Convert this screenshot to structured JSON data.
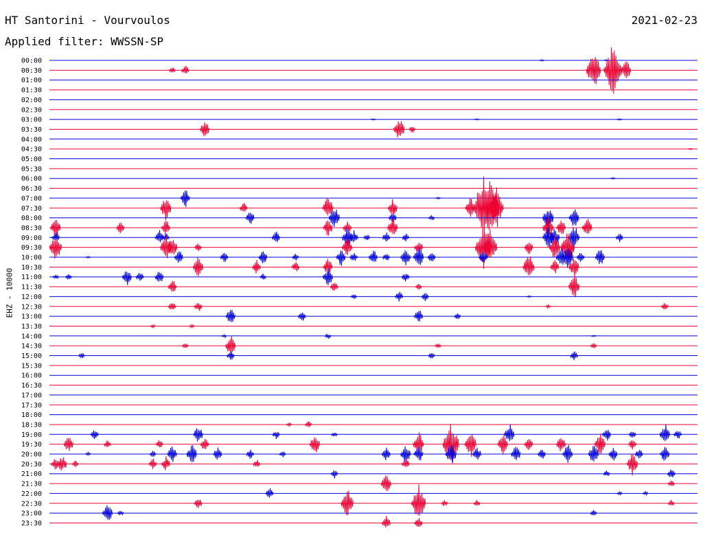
{
  "header": {
    "station": "HT Santorini - Vourvoulos",
    "date": "2021-02-23",
    "filter": "Applied filter: WWSSN-SP"
  },
  "channel_label": "EHZ - 10000",
  "colors": {
    "even_hour": "#0000dd",
    "half_hour": "#ee0033"
  },
  "chart_data": {
    "type": "line",
    "title": "HT Santorini - Vourvoulos",
    "ylabel": "EHZ - 10000",
    "date": "2021-02-23",
    "filter": "WWSSN-SP",
    "ticks": [
      "00:00",
      "00:30",
      "01:00",
      "01:30",
      "02:00",
      "02:30",
      "03:00",
      "03:30",
      "04:00",
      "04:30",
      "05:00",
      "05:30",
      "06:00",
      "06:30",
      "07:00",
      "07:30",
      "08:00",
      "08:30",
      "09:00",
      "09:30",
      "10:00",
      "10:30",
      "11:00",
      "11:30",
      "12:00",
      "12:30",
      "13:00",
      "13:30",
      "14:00",
      "14:30",
      "15:00",
      "15:30",
      "16:00",
      "16:30",
      "17:00",
      "17:30",
      "18:00",
      "18:30",
      "19:00",
      "19:30",
      "20:00",
      "20:30",
      "21:00",
      "21:30",
      "22:00",
      "22:30",
      "23:00",
      "23:30"
    ],
    "trace_minutes": 30,
    "series": [
      {
        "trace": "00:00",
        "events": [
          [
            0.76,
            0.1
          ],
          [
            0.86,
            0.1
          ]
        ]
      },
      {
        "trace": "00:30",
        "events": [
          [
            0.19,
            0.4
          ],
          [
            0.21,
            0.6
          ],
          [
            0.84,
            2.2
          ],
          [
            0.87,
            3.0
          ],
          [
            0.89,
            1.2
          ]
        ]
      },
      {
        "trace": "01:00",
        "events": []
      },
      {
        "trace": "01:30",
        "events": []
      },
      {
        "trace": "02:00",
        "events": []
      },
      {
        "trace": "02:30",
        "events": []
      },
      {
        "trace": "03:00",
        "events": [
          [
            0.5,
            0.1
          ],
          [
            0.66,
            0.1
          ],
          [
            0.88,
            0.1
          ]
        ]
      },
      {
        "trace": "03:30",
        "events": [
          [
            0.24,
            1.0
          ],
          [
            0.54,
            1.3
          ],
          [
            0.56,
            0.4
          ]
        ]
      },
      {
        "trace": "04:00",
        "events": []
      },
      {
        "trace": "04:30",
        "events": [
          [
            0.99,
            0.1
          ]
        ]
      },
      {
        "trace": "05:00",
        "events": []
      },
      {
        "trace": "05:30",
        "events": []
      },
      {
        "trace": "06:00",
        "events": [
          [
            0.87,
            0.1
          ]
        ]
      },
      {
        "trace": "06:30",
        "events": []
      },
      {
        "trace": "07:00",
        "events": [
          [
            0.21,
            1.0
          ],
          [
            0.6,
            0.1
          ]
        ]
      },
      {
        "trace": "07:30",
        "events": [
          [
            0.18,
            1.4
          ],
          [
            0.3,
            0.6
          ],
          [
            0.43,
            1.3
          ],
          [
            0.53,
            1.0
          ],
          [
            0.65,
            1.2
          ],
          [
            0.67,
            3.5
          ],
          [
            0.68,
            3.0
          ],
          [
            0.69,
            2.2
          ]
        ]
      },
      {
        "trace": "08:00",
        "events": [
          [
            0.31,
            0.8
          ],
          [
            0.44,
            1.3
          ],
          [
            0.53,
            0.6
          ],
          [
            0.59,
            0.3
          ],
          [
            0.77,
            1.3
          ],
          [
            0.81,
            1.2
          ]
        ]
      },
      {
        "trace": "08:30",
        "events": [
          [
            0.01,
            1.1
          ],
          [
            0.11,
            0.7
          ],
          [
            0.18,
            0.9
          ],
          [
            0.43,
            1.0
          ],
          [
            0.46,
            0.8
          ],
          [
            0.53,
            1.2
          ],
          [
            0.77,
            1.4
          ],
          [
            0.79,
            1.0
          ],
          [
            0.83,
            1.1
          ]
        ]
      },
      {
        "trace": "09:00",
        "events": [
          [
            0.01,
            0.6
          ],
          [
            0.17,
            0.8
          ],
          [
            0.18,
            0.5
          ],
          [
            0.35,
            0.7
          ],
          [
            0.46,
            1.2
          ],
          [
            0.47,
            0.8
          ],
          [
            0.49,
            0.4
          ],
          [
            0.52,
            0.6
          ],
          [
            0.55,
            0.5
          ],
          [
            0.77,
            1.3
          ],
          [
            0.78,
            1.1
          ],
          [
            0.81,
            1.4
          ],
          [
            0.88,
            0.5
          ]
        ]
      },
      {
        "trace": "09:30",
        "events": [
          [
            0.01,
            1.6
          ],
          [
            0.18,
            1.4
          ],
          [
            0.19,
            1.2
          ],
          [
            0.23,
            0.5
          ],
          [
            0.46,
            1.2
          ],
          [
            0.57,
            0.8
          ],
          [
            0.67,
            2.5
          ],
          [
            0.68,
            2.1
          ],
          [
            0.74,
            0.8
          ],
          [
            0.78,
            1.4
          ],
          [
            0.8,
            2.0
          ]
        ]
      },
      {
        "trace": "10:00",
        "events": [
          [
            0.06,
            0.1
          ],
          [
            0.2,
            0.8
          ],
          [
            0.27,
            0.6
          ],
          [
            0.33,
            0.8
          ],
          [
            0.38,
            0.4
          ],
          [
            0.45,
            1.0
          ],
          [
            0.47,
            0.6
          ],
          [
            0.5,
            0.9
          ],
          [
            0.52,
            0.5
          ],
          [
            0.55,
            1.1
          ],
          [
            0.57,
            1.2
          ],
          [
            0.59,
            0.6
          ],
          [
            0.67,
            0.8
          ],
          [
            0.79,
            1.1
          ],
          [
            0.8,
            1.3
          ],
          [
            0.82,
            0.6
          ],
          [
            0.85,
            1.0
          ]
        ]
      },
      {
        "trace": "10:30",
        "events": [
          [
            0.23,
            1.2
          ],
          [
            0.32,
            0.8
          ],
          [
            0.38,
            0.6
          ],
          [
            0.43,
            1.0
          ],
          [
            0.74,
            1.5
          ],
          [
            0.78,
            0.8
          ],
          [
            0.81,
            1.1
          ]
        ]
      },
      {
        "trace": "11:00",
        "events": [
          [
            0.01,
            0.3
          ],
          [
            0.03,
            0.4
          ],
          [
            0.12,
            1.0
          ],
          [
            0.14,
            0.6
          ],
          [
            0.17,
            0.8
          ],
          [
            0.33,
            0.4
          ],
          [
            0.43,
            1.2
          ],
          [
            0.55,
            0.6
          ]
        ]
      },
      {
        "trace": "11:30",
        "events": [
          [
            0.19,
            0.8
          ],
          [
            0.44,
            0.6
          ],
          [
            0.57,
            0.4
          ],
          [
            0.81,
            1.4
          ]
        ]
      },
      {
        "trace": "12:00",
        "events": [
          [
            0.47,
            0.3
          ],
          [
            0.54,
            0.6
          ],
          [
            0.58,
            0.5
          ],
          [
            0.74,
            0.1
          ]
        ]
      },
      {
        "trace": "12:30",
        "events": [
          [
            0.19,
            0.6
          ],
          [
            0.23,
            0.6
          ],
          [
            0.77,
            0.2
          ],
          [
            0.95,
            0.5
          ]
        ]
      },
      {
        "trace": "13:00",
        "events": [
          [
            0.28,
            1.0
          ],
          [
            0.39,
            0.6
          ],
          [
            0.57,
            0.8
          ],
          [
            0.63,
            0.4
          ]
        ]
      },
      {
        "trace": "13:30",
        "events": [
          [
            0.16,
            0.2
          ],
          [
            0.22,
            0.2
          ]
        ]
      },
      {
        "trace": "14:00",
        "events": [
          [
            0.27,
            0.2
          ],
          [
            0.43,
            0.3
          ],
          [
            0.84,
            0.1
          ]
        ]
      },
      {
        "trace": "14:30",
        "events": [
          [
            0.21,
            0.4
          ],
          [
            0.28,
            1.2
          ],
          [
            0.6,
            0.3
          ],
          [
            0.84,
            0.4
          ]
        ]
      },
      {
        "trace": "15:00",
        "events": [
          [
            0.05,
            0.4
          ],
          [
            0.28,
            0.6
          ],
          [
            0.59,
            0.4
          ],
          [
            0.81,
            0.6
          ]
        ]
      },
      {
        "trace": "15:30",
        "events": []
      },
      {
        "trace": "16:00",
        "events": []
      },
      {
        "trace": "16:30",
        "events": []
      },
      {
        "trace": "17:00",
        "events": []
      },
      {
        "trace": "17:30",
        "events": []
      },
      {
        "trace": "18:00",
        "events": []
      },
      {
        "trace": "18:30",
        "events": [
          [
            0.37,
            0.2
          ],
          [
            0.4,
            0.4
          ]
        ]
      },
      {
        "trace": "19:00",
        "events": [
          [
            0.07,
            0.6
          ],
          [
            0.23,
            1.0
          ],
          [
            0.35,
            0.5
          ],
          [
            0.44,
            0.3
          ],
          [
            0.71,
            1.2
          ],
          [
            0.86,
            0.8
          ],
          [
            0.9,
            0.5
          ],
          [
            0.95,
            1.2
          ],
          [
            0.97,
            0.6
          ]
        ]
      },
      {
        "trace": "19:30",
        "events": [
          [
            0.03,
            1.0
          ],
          [
            0.09,
            0.5
          ],
          [
            0.17,
            0.5
          ],
          [
            0.24,
            0.8
          ],
          [
            0.41,
            1.2
          ],
          [
            0.57,
            1.4
          ],
          [
            0.62,
            2.5
          ],
          [
            0.65,
            1.5
          ],
          [
            0.7,
            1.2
          ],
          [
            0.74,
            0.8
          ],
          [
            0.79,
            1.0
          ],
          [
            0.85,
            1.3
          ],
          [
            0.9,
            0.6
          ]
        ]
      },
      {
        "trace": "20:00",
        "events": [
          [
            0.06,
            0.2
          ],
          [
            0.16,
            0.4
          ],
          [
            0.19,
            1.0
          ],
          [
            0.22,
            1.2
          ],
          [
            0.26,
            0.8
          ],
          [
            0.31,
            0.6
          ],
          [
            0.36,
            0.4
          ],
          [
            0.52,
            0.8
          ],
          [
            0.55,
            1.1
          ],
          [
            0.57,
            1.0
          ],
          [
            0.62,
            1.3
          ],
          [
            0.66,
            0.8
          ],
          [
            0.72,
            1.0
          ],
          [
            0.76,
            0.6
          ],
          [
            0.8,
            1.1
          ],
          [
            0.84,
            1.2
          ],
          [
            0.87,
            0.8
          ],
          [
            0.91,
            0.6
          ],
          [
            0.95,
            1.0
          ]
        ]
      },
      {
        "trace": "20:30",
        "events": [
          [
            0.01,
            0.8
          ],
          [
            0.02,
            1.0
          ],
          [
            0.04,
            0.4
          ],
          [
            0.16,
            0.6
          ],
          [
            0.18,
            0.8
          ],
          [
            0.32,
            0.5
          ],
          [
            0.55,
            0.6
          ],
          [
            0.9,
            1.3
          ]
        ]
      },
      {
        "trace": "21:00",
        "events": [
          [
            0.44,
            0.5
          ],
          [
            0.86,
            0.4
          ],
          [
            0.96,
            0.6
          ]
        ]
      },
      {
        "trace": "21:30",
        "events": [
          [
            0.52,
            1.2
          ],
          [
            0.96,
            0.4
          ]
        ]
      },
      {
        "trace": "22:00",
        "events": [
          [
            0.34,
            0.6
          ],
          [
            0.88,
            0.2
          ],
          [
            0.92,
            0.2
          ]
        ]
      },
      {
        "trace": "22:30",
        "events": [
          [
            0.23,
            0.6
          ],
          [
            0.46,
            1.6
          ],
          [
            0.57,
            2.1
          ],
          [
            0.61,
            0.4
          ],
          [
            0.66,
            0.4
          ],
          [
            0.96,
            0.4
          ]
        ]
      },
      {
        "trace": "23:00",
        "events": [
          [
            0.09,
            1.2
          ],
          [
            0.11,
            0.3
          ],
          [
            0.84,
            0.4
          ]
        ]
      },
      {
        "trace": "23:30",
        "events": [
          [
            0.52,
            0.8
          ],
          [
            0.57,
            0.6
          ]
        ]
      }
    ]
  }
}
